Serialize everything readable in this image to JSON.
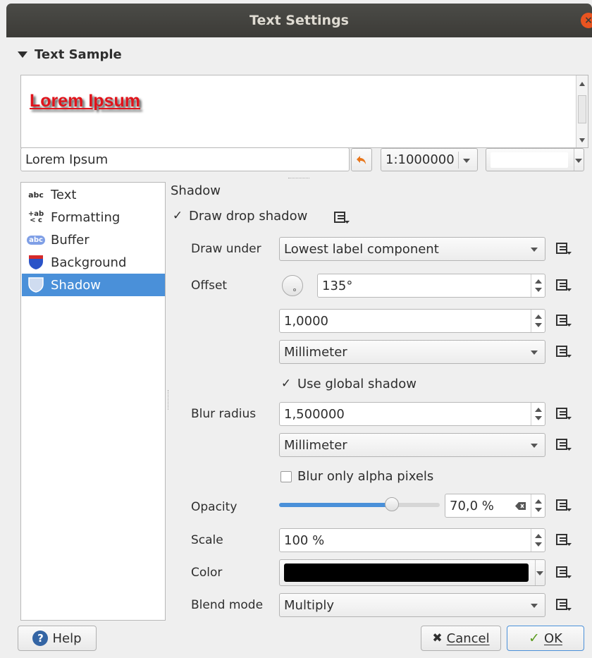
{
  "window": {
    "title": "Text Settings",
    "close_glyph": "×"
  },
  "sample": {
    "section_title": "Text Sample",
    "preview_text": "Lorem Ipsum",
    "text_input_value": "Lorem Ipsum",
    "scale_value": "1:1000000",
    "background_color": "#ffffff"
  },
  "sidebar": {
    "items": [
      {
        "label": "Text",
        "icon": "text-abc-icon"
      },
      {
        "label": "Formatting",
        "icon": "formatting-icon"
      },
      {
        "label": "Buffer",
        "icon": "buffer-icon"
      },
      {
        "label": "Background",
        "icon": "background-icon"
      },
      {
        "label": "Shadow",
        "icon": "shadow-icon",
        "selected": true
      }
    ]
  },
  "shadow": {
    "heading": "Shadow",
    "draw_drop_shadow_label": "Draw drop shadow",
    "draw_drop_shadow_checked": true,
    "draw_under_label": "Draw under",
    "draw_under_value": "Lowest label component",
    "offset_label": "Offset",
    "offset_angle": "135°",
    "offset_distance": "1,0000",
    "offset_unit": "Millimeter",
    "use_global_shadow_label": "Use global shadow",
    "use_global_shadow_checked": true,
    "blur_radius_label": "Blur radius",
    "blur_radius_value": "1,500000",
    "blur_unit": "Millimeter",
    "blur_only_alpha_label": "Blur only alpha pixels",
    "blur_only_alpha_checked": false,
    "opacity_label": "Opacity",
    "opacity_value": "70,0 %",
    "opacity_fraction": 0.7,
    "scale_label": "Scale",
    "scale_value": "100 %",
    "color_label": "Color",
    "color_value": "#000000",
    "blend_mode_label": "Blend mode",
    "blend_mode_value": "Multiply"
  },
  "buttons": {
    "help": "Help",
    "cancel": "Cancel",
    "ok": "OK"
  },
  "colors": {
    "accent": "#4a90d9",
    "close": "#e95420",
    "preview_text": "#e0131b"
  }
}
